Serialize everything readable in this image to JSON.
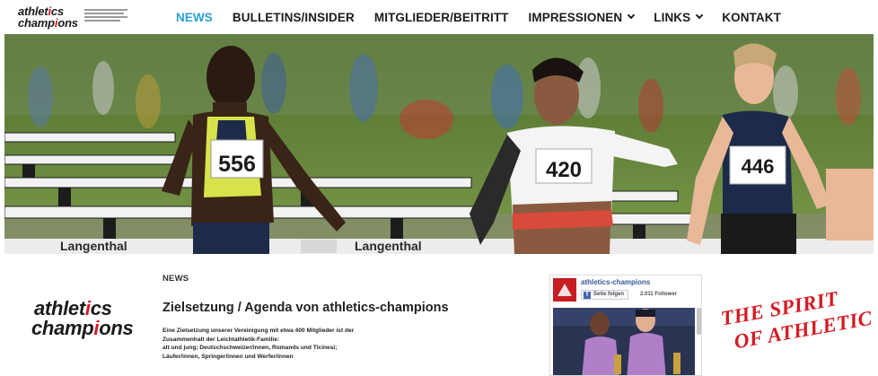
{
  "header": {
    "logo": {
      "line1_a": "athlet",
      "line1_b": "i",
      "line1_c": "cs",
      "line2_a": "champ",
      "line2_b": "i",
      "line2_c": "ons"
    },
    "nav": [
      {
        "label": "NEWS",
        "active": true,
        "dropdown": false
      },
      {
        "label": "BULLETINS/INSIDER",
        "active": false,
        "dropdown": false
      },
      {
        "label": "MITGLIEDER/BEITRITT",
        "active": false,
        "dropdown": false
      },
      {
        "label": "IMPRESSIONEN",
        "active": false,
        "dropdown": true
      },
      {
        "label": "LINKS",
        "active": false,
        "dropdown": true
      },
      {
        "label": "KONTAKT",
        "active": false,
        "dropdown": false
      }
    ]
  },
  "hero": {
    "bibs": [
      "556",
      "420",
      "446"
    ],
    "banner_text": "Langenthal"
  },
  "content": {
    "logo": {
      "line1_a": "athlet",
      "line1_b": "i",
      "line1_c": "cs",
      "line2_a": "champ",
      "line2_b": "i",
      "line2_c": "ons"
    },
    "kicker": "NEWS",
    "title": "Zielsetzung / Agenda von athletics-champions",
    "body": [
      "Eine Zielsetzung unserer Vereinigung mit etwa 400 Mitglieder ist der",
      "Zusammenhalt der Leichtathletik-Familie:",
      "alt und jung; Deutschschweizer/innen, Romands und Ticinesi;",
      "Läufer/innen, Springer/innen und Werfer/innen"
    ]
  },
  "facebook_widget": {
    "page_name": "athletics-champions",
    "follow_label": "Seite folgen",
    "followers": "2.011 Follower"
  },
  "spirit_logo": {
    "line1": "THE SPIRIT",
    "line2": "OF ATHLETICS"
  },
  "colors": {
    "accent": "#2a9fd6",
    "brand_red": "#d71920",
    "text_dark": "#1c1c1c"
  }
}
